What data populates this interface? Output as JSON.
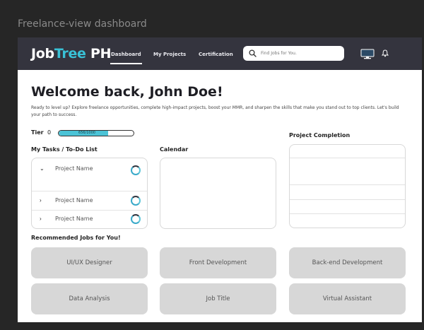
{
  "window": {
    "title": "Freelance-view dashboard"
  },
  "brand": {
    "name_part1": "Job",
    "name_part2": "Tree",
    "name_part3": " PH",
    "accent_color": "#39c1d6",
    "nav_background": "#34343e"
  },
  "nav": {
    "items": [
      {
        "label": "Dashboard",
        "active": true
      },
      {
        "label": "My Projects",
        "active": false
      },
      {
        "label": "Certification",
        "active": false
      }
    ],
    "search_placeholder": "Find Jobs for You.",
    "icons": [
      "search-icon",
      "monitor-icon",
      "bell-icon"
    ]
  },
  "hero": {
    "title": "Welcome back, John Doe!",
    "intro": "Ready to level up? Explore freelance opportunities, complete high-impact projects, boost your MMR, and sharpen the skills that make you stand out to top clients. Let's build your path to success."
  },
  "tier": {
    "label": "Tier",
    "level": "0",
    "progress_text": "656/1000",
    "progress_fraction": 0.656,
    "progress_color": "#4bc3d6"
  },
  "sections": {
    "tasks_title": "My Tasks / To-Do List",
    "calendar_title": "Calendar",
    "completion_title": "Project Completion",
    "jobs_title": "Recommended Jobs for You!"
  },
  "tasks": [
    {
      "name": "Project Name",
      "expanded": true,
      "chevron": "chevron-down-icon"
    },
    {
      "name": "Project Name",
      "expanded": false,
      "chevron": "chevron-right-icon"
    },
    {
      "name": "Project Name",
      "expanded": false,
      "chevron": "chevron-right-icon"
    }
  ],
  "jobs": [
    {
      "label": "UI/UX Designer"
    },
    {
      "label": "Front Development"
    },
    {
      "label": "Back-end Development"
    },
    {
      "label": "Data Analysis"
    },
    {
      "label": "Job Title"
    },
    {
      "label": "Virtual Assistant"
    }
  ]
}
